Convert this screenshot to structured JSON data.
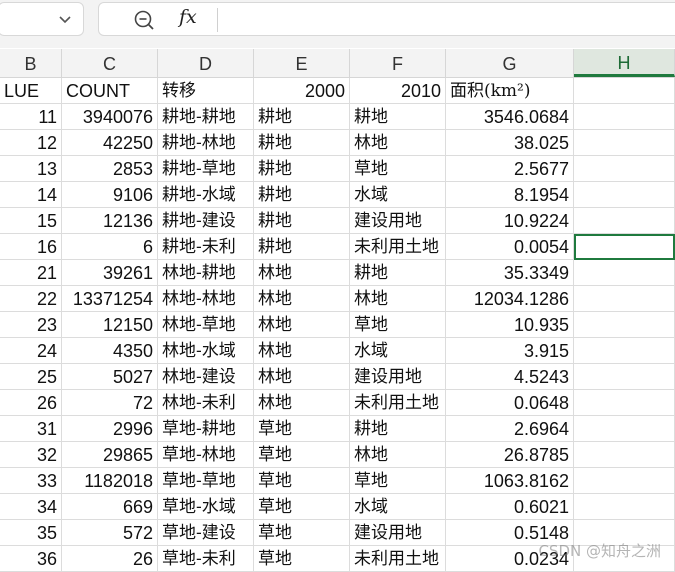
{
  "columns": [
    {
      "letter": "B",
      "active": false
    },
    {
      "letter": "C",
      "active": false
    },
    {
      "letter": "D",
      "active": false
    },
    {
      "letter": "E",
      "active": false
    },
    {
      "letter": "F",
      "active": false
    },
    {
      "letter": "G",
      "active": false
    },
    {
      "letter": "H",
      "active": true
    }
  ],
  "header_row": [
    "LUE",
    "COUNT",
    "转移",
    "2000",
    "2010",
    "面积(km²)",
    ""
  ],
  "rows": [
    [
      "11",
      "3940076",
      "耕地-耕地",
      "耕地",
      "耕地",
      "3546.0684",
      ""
    ],
    [
      "12",
      "42250",
      "耕地-林地",
      "耕地",
      "林地",
      "38.025",
      ""
    ],
    [
      "13",
      "2853",
      "耕地-草地",
      "耕地",
      "草地",
      "2.5677",
      ""
    ],
    [
      "14",
      "9106",
      "耕地-水域",
      "耕地",
      "水域",
      "8.1954",
      ""
    ],
    [
      "15",
      "12136",
      "耕地-建设",
      "耕地",
      "建设用地",
      "10.9224",
      ""
    ],
    [
      "16",
      "6",
      "耕地-未利",
      "耕地",
      "未利用土地",
      "0.0054",
      ""
    ],
    [
      "21",
      "39261",
      "林地-耕地",
      "林地",
      "耕地",
      "35.3349",
      ""
    ],
    [
      "22",
      "13371254",
      "林地-林地",
      "林地",
      "林地",
      "12034.1286",
      ""
    ],
    [
      "23",
      "12150",
      "林地-草地",
      "林地",
      "草地",
      "10.935",
      ""
    ],
    [
      "24",
      "4350",
      "林地-水域",
      "林地",
      "水域",
      "3.915",
      ""
    ],
    [
      "25",
      "5027",
      "林地-建设",
      "林地",
      "建设用地",
      "4.5243",
      ""
    ],
    [
      "26",
      "72",
      "林地-未利",
      "林地",
      "未利用土地",
      "0.0648",
      ""
    ],
    [
      "31",
      "2996",
      "草地-耕地",
      "草地",
      "耕地",
      "2.6964",
      ""
    ],
    [
      "32",
      "29865",
      "草地-林地",
      "草地",
      "林地",
      "26.8785",
      ""
    ],
    [
      "33",
      "1182018",
      "草地-草地",
      "草地",
      "草地",
      "1063.8162",
      ""
    ],
    [
      "34",
      "669",
      "草地-水域",
      "草地",
      "水域",
      "0.6021",
      ""
    ],
    [
      "35",
      "572",
      "草地-建设",
      "草地",
      "建设用地",
      "0.5148",
      ""
    ],
    [
      "36",
      "26",
      "草地-未利",
      "草地",
      "未利用土地",
      "0.0234",
      ""
    ]
  ],
  "watermark": "CSDN @知舟之洲",
  "colors": {
    "accent": "#1f7a3e",
    "header_bg": "#f3f3f3",
    "grid": "#dcdcdc"
  }
}
